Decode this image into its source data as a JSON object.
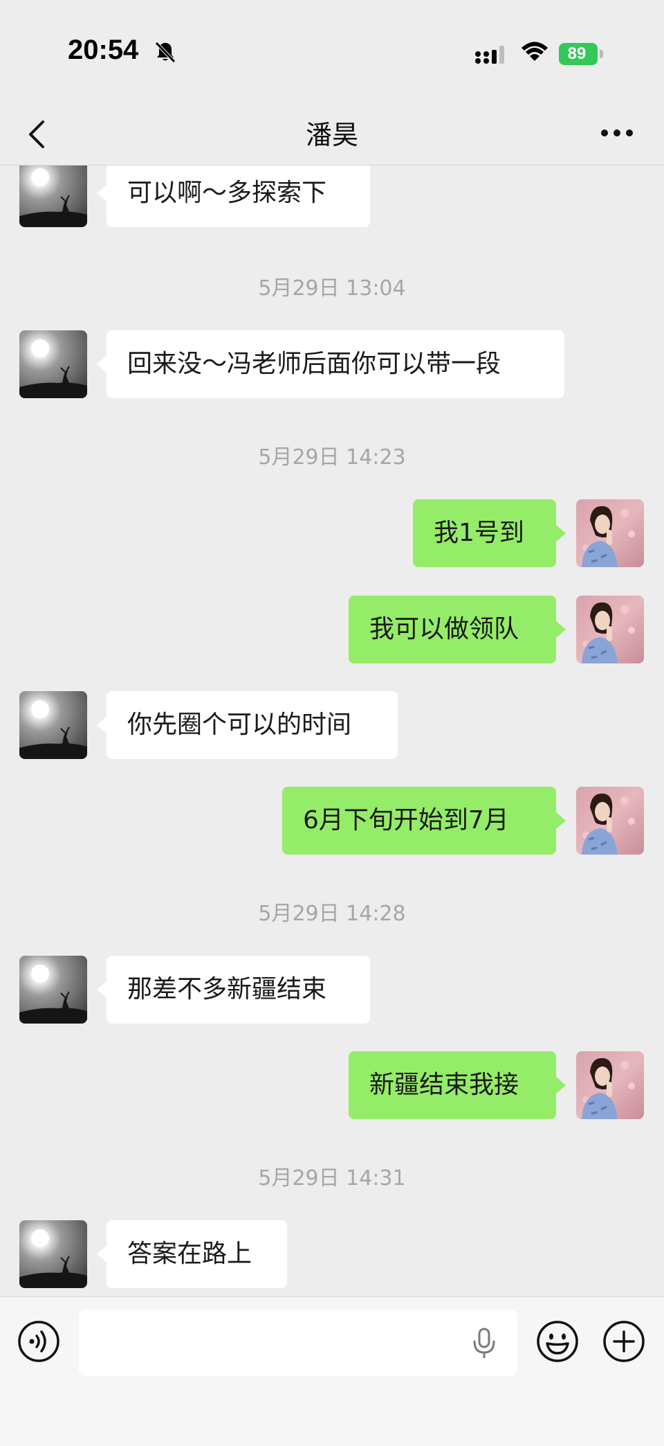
{
  "status_bar": {
    "time": "20:54",
    "battery": "89",
    "icons": [
      "bell-slash-icon",
      "signal-icon",
      "wifi-icon",
      "battery-charging-icon"
    ]
  },
  "nav": {
    "title": "潘昊",
    "back_icon": "chevron-left-icon",
    "more_icon": "ellipsis-icon"
  },
  "messages": [
    {
      "type": "text",
      "side": "left",
      "text": "可以啊～多探索下"
    },
    {
      "type": "time",
      "text": "5月29日 13:04"
    },
    {
      "type": "text",
      "side": "left",
      "text": "回来没～冯老师后面你可以带一段"
    },
    {
      "type": "time",
      "text": "5月29日 14:23"
    },
    {
      "type": "text",
      "side": "right",
      "text": "我1号到"
    },
    {
      "type": "text",
      "side": "right",
      "text": "我可以做领队"
    },
    {
      "type": "text",
      "side": "left",
      "text": "你先圈个可以的时间"
    },
    {
      "type": "text",
      "side": "right",
      "text": "6月下旬开始到7月"
    },
    {
      "type": "time",
      "text": "5月29日 14:28"
    },
    {
      "type": "text",
      "side": "left",
      "text": "那差不多新疆结束"
    },
    {
      "type": "text",
      "side": "right",
      "text": "新疆结束我接"
    },
    {
      "type": "time",
      "text": "5月29日 14:31"
    },
    {
      "type": "text",
      "side": "left",
      "text": "答案在路上"
    }
  ],
  "input_bar": {
    "input_value": "",
    "icons": [
      "voice-icon",
      "microphone-icon",
      "emoji-icon",
      "plus-icon"
    ]
  },
  "colors": {
    "background": "#ededed",
    "sent_bubble": "#95ec69",
    "received_bubble": "#ffffff",
    "timestamp": "#a6a6a6",
    "battery": "#34c759"
  }
}
